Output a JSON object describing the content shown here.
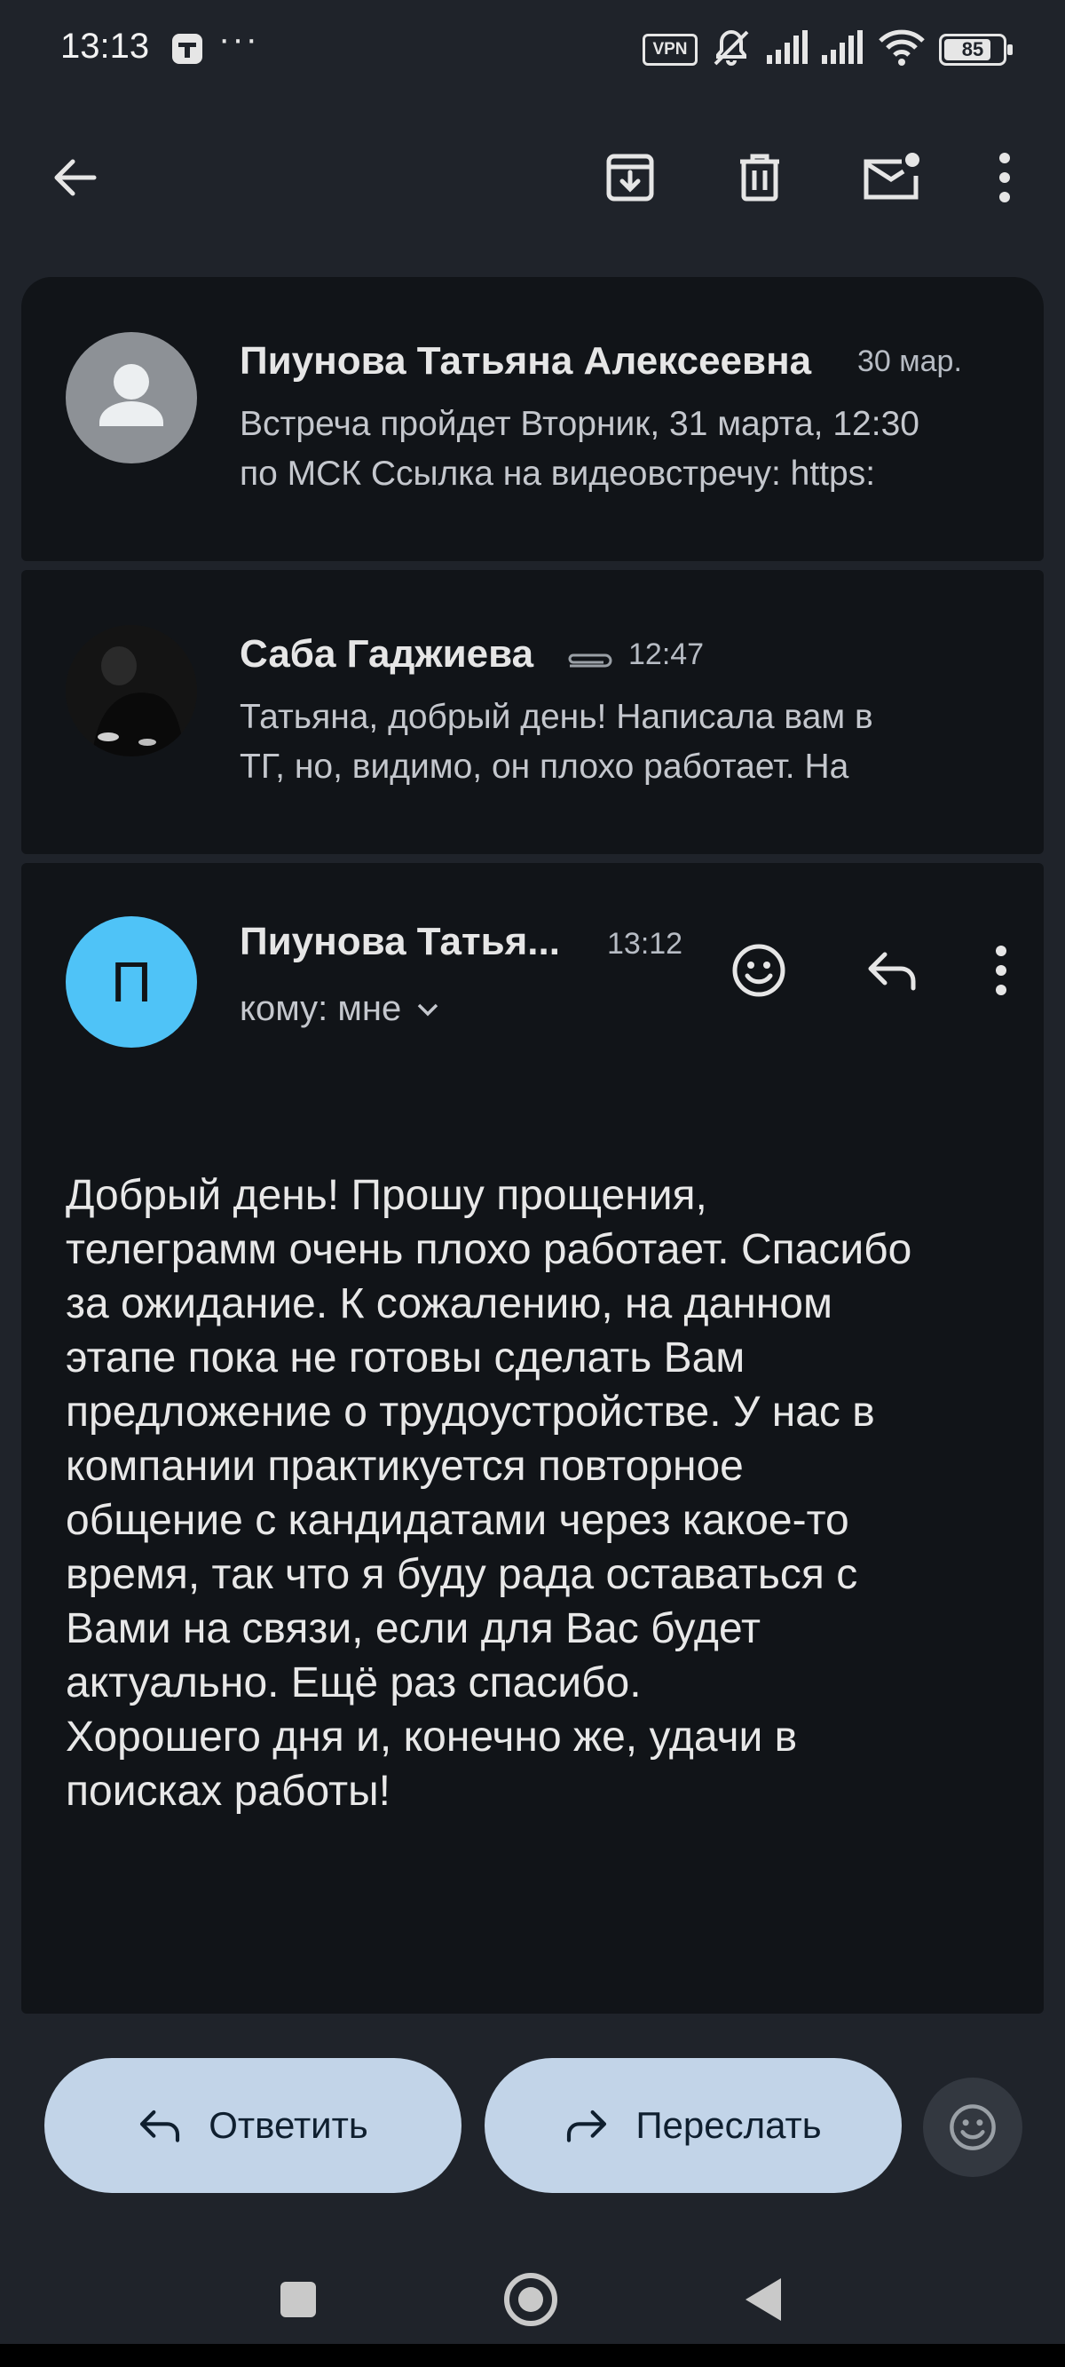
{
  "status_bar": {
    "time": "13:13",
    "dots": "···",
    "vpn": "VPN",
    "battery": "85"
  },
  "toolbar": {
    "back_icon": "arrow-left-icon",
    "archive_icon": "archive-icon",
    "delete_icon": "trash-icon",
    "mark_unread_icon": "mail-unread-icon",
    "more_icon": "more-vert-icon"
  },
  "messages": [
    {
      "sender": "Пиунова Татьяна Алексеевна",
      "date": "30 мар.",
      "snippet_line1": "Встреча пройдет Вторник, 31 марта, 12:30",
      "snippet_line2": "по МСК Ссылка на видеовстречу: https:"
    },
    {
      "sender": "Саба Гаджиева",
      "date": "12:47",
      "snippet_line1": "Татьяна, добрый день! Написала вам в",
      "snippet_line2": "ТГ, но, видимо, он плохо работает. На"
    }
  ],
  "open_message": {
    "avatar_letter": "П",
    "avatar_color": "#4fc3f7",
    "sender": "Пиунова Татья...",
    "time": "13:12",
    "recipient": "кому: мне",
    "body_lines": [
      "Добрый день! Прошу прощения,",
      "телеграмм очень плохо работает.  Спасибо",
      "за ожидание. К сожалению, на данном",
      "этапе пока не готовы сделать Вам",
      "предложение о трудоустройстве. У нас в",
      "компании практикуется повторное",
      "общение с кандидатами через какое-то",
      "время, так что я буду рада оставаться с",
      "Вами на связи, если для Вас будет",
      "актуально. Ещё раз спасибо.",
      "Хорошего дня и, конечно же, удачи в",
      "поисках работы!"
    ]
  },
  "actions": {
    "reply": "Ответить",
    "forward": "Переслать"
  },
  "colors": {
    "background": "#1f232a",
    "card": "#111418",
    "pill": "#c2d4e8"
  }
}
